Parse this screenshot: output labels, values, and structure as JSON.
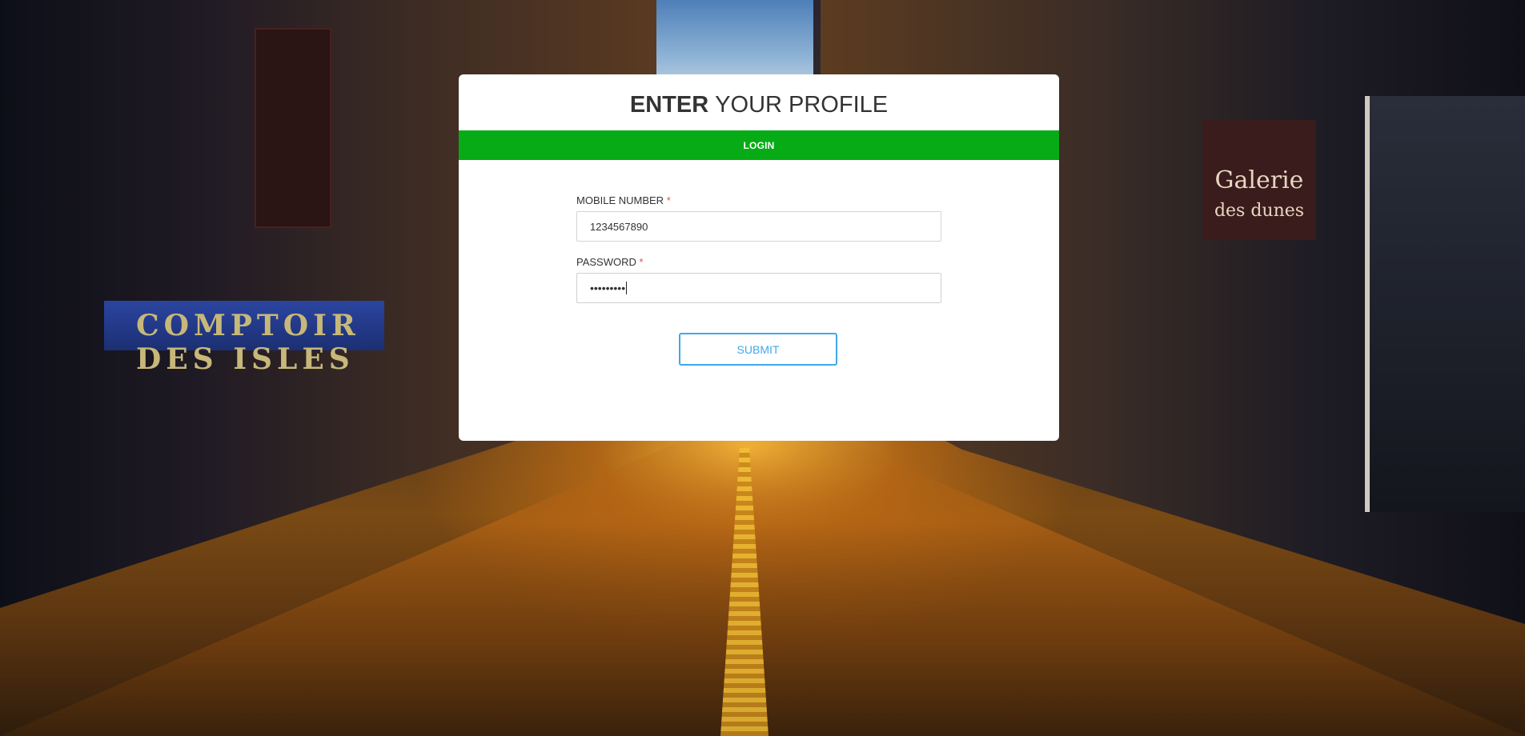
{
  "background": {
    "description_icon": "street-photo-background",
    "signs": {
      "comptoir": "COMPTOIR DES ISLES",
      "galerie_line1": "Galerie",
      "galerie_line2": "des dunes"
    }
  },
  "login_card": {
    "title_bold": "ENTER",
    "title_rest": "YOUR PROFILE",
    "bar_label": "LOGIN",
    "mobile": {
      "label": "MOBILE NUMBER",
      "required_mark": "*",
      "value": "1234567890"
    },
    "password": {
      "label": "PASSWORD",
      "required_mark": "*",
      "masked_value": "•••••••••"
    },
    "submit_label": "SUBMIT"
  },
  "colors": {
    "bar_green": "#06ab15",
    "submit_blue": "#3fa9e8",
    "required_red": "#d9534f"
  }
}
